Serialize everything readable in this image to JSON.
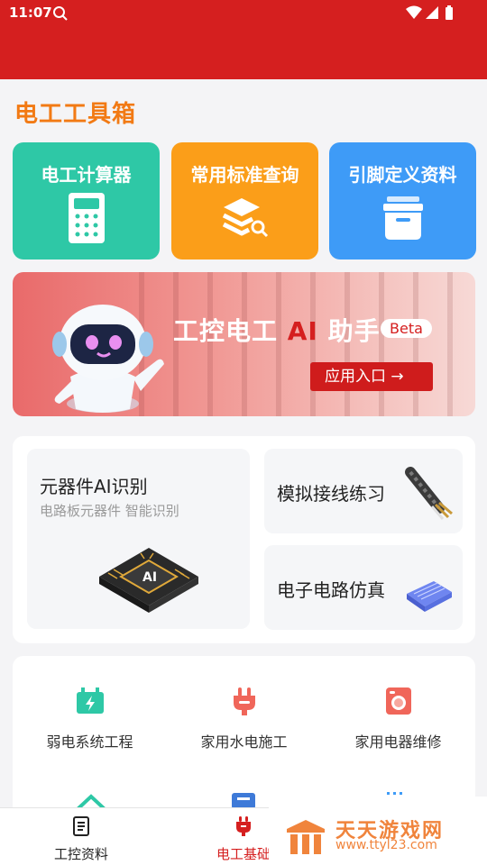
{
  "status_bar": {
    "time": "11:07",
    "accent": "#d51f1f"
  },
  "page": {
    "title": "电工工具箱"
  },
  "tools": [
    {
      "label": "电工计算器",
      "icon": "calculator-icon",
      "color": "#2ec8a6"
    },
    {
      "label": "常用标准查询",
      "icon": "layers-search-icon",
      "color": "#fb9e19"
    },
    {
      "label": "引脚定义资料",
      "icon": "storage-box-icon",
      "color": "#3e9bf7"
    }
  ],
  "banner": {
    "title_prefix": "工控电工",
    "title_ai": "AI",
    "title_suffix": "助手",
    "badge": "Beta",
    "button_label": "应用入口 →"
  },
  "features": {
    "ai_recognition": {
      "title": "元器件AI识别",
      "subtitle": "电路板元器件 智能识别"
    },
    "wiring_practice": {
      "label": "模拟接线练习",
      "icon": "cable-icon"
    },
    "circuit_sim": {
      "label": "电子电路仿真",
      "icon": "chip-board-icon"
    }
  },
  "services": [
    {
      "label": "弱电系统工程",
      "icon": "low-voltage-icon"
    },
    {
      "label": "家用水电施工",
      "icon": "plug-icon"
    },
    {
      "label": "家用电器维修",
      "icon": "washing-machine-icon"
    }
  ],
  "bottom_nav": [
    {
      "label": "工控资料",
      "icon": "document-icon",
      "active": false
    },
    {
      "label": "电工基础",
      "icon": "plug-nav-icon",
      "active": true
    }
  ],
  "watermark": {
    "name": "天天游戏网",
    "url": "www.ttyl23.com"
  }
}
